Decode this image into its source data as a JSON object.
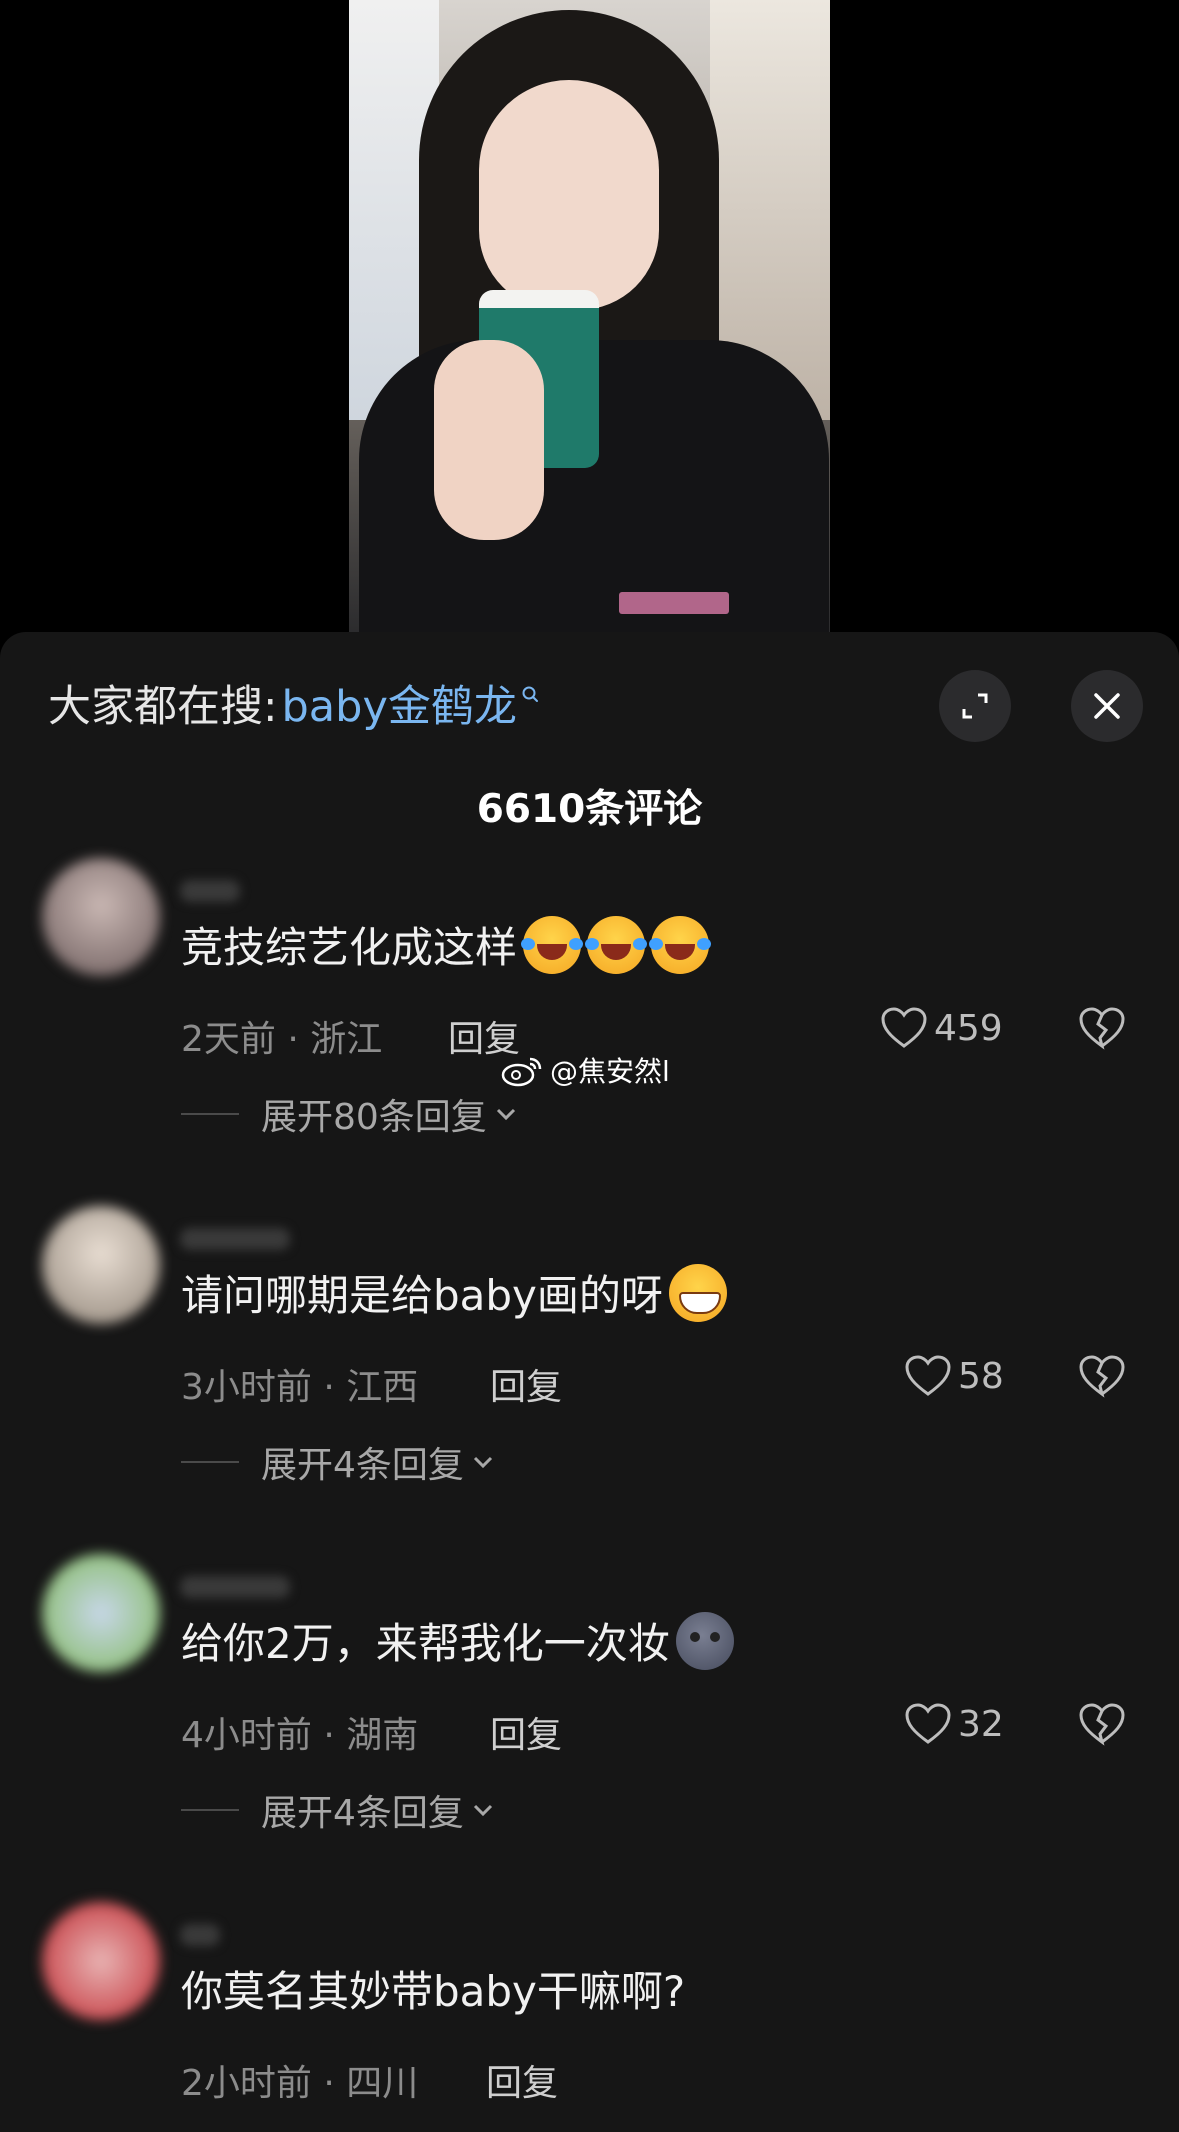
{
  "search": {
    "prefix": "大家都在搜:",
    "keyword": "baby金鹤龙"
  },
  "comments_header": {
    "count_label": "6610条评论"
  },
  "comments": [
    {
      "text": "竞技综艺化成这样",
      "time_location": "2天前 · 浙江",
      "reply_label": "回复",
      "likes": "459",
      "expand_label": "展开80条回复"
    },
    {
      "text": "请问哪期是给baby画的呀",
      "time_location": "3小时前 · 江西",
      "reply_label": "回复",
      "likes": "58",
      "expand_label": "展开4条回复"
    },
    {
      "text": "给你2万，来帮我化一次妆",
      "time_location": "4小时前 · 湖南",
      "reply_label": "回复",
      "likes": "32",
      "expand_label": "展开4条回复"
    },
    {
      "text": "你莫名其妙带baby干嘛啊?",
      "time_location": "2小时前 · 四川",
      "reply_label": "回复"
    }
  ],
  "watermark": {
    "text": "@焦安然l"
  },
  "colors": {
    "accent": "#7ab6f0",
    "sheet_bg": "#161616"
  }
}
